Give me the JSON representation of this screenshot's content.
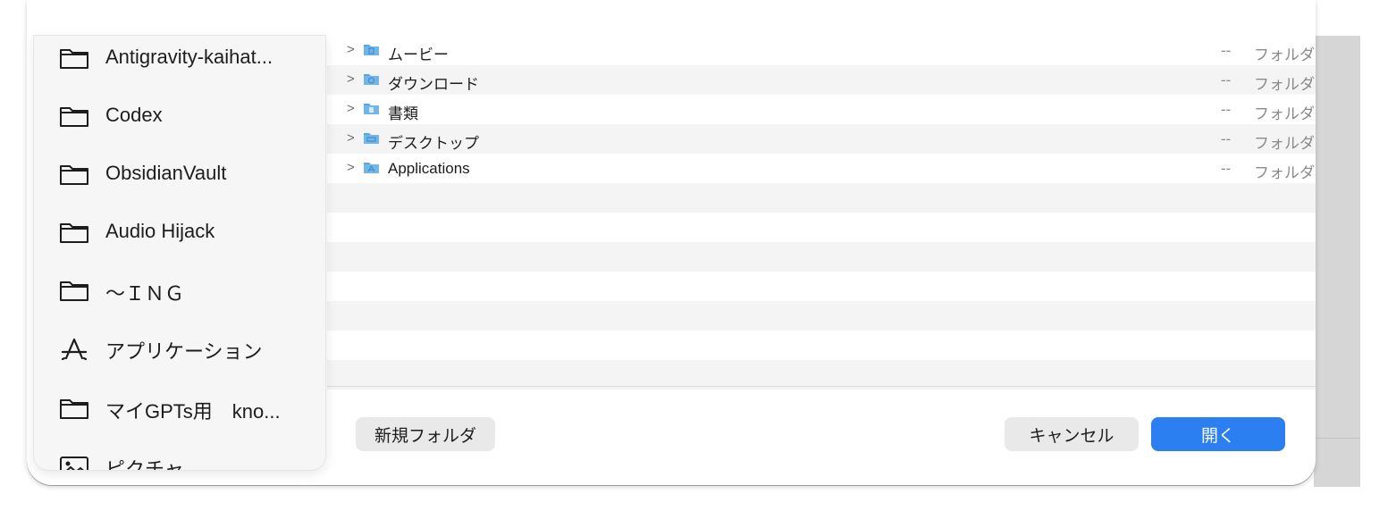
{
  "colors": {
    "accent": "#2b7ff1",
    "folder_blue": "#5aa7e0"
  },
  "sidebar": {
    "items": [
      {
        "label": "Antigravity-kaihat...",
        "icon": "folder-icon"
      },
      {
        "label": "Codex",
        "icon": "folder-icon"
      },
      {
        "label": "ObsidianVault",
        "icon": "folder-icon"
      },
      {
        "label": "Audio Hijack",
        "icon": "folder-icon"
      },
      {
        "label": "～ＩＮＧ",
        "icon": "folder-icon"
      },
      {
        "label": "アプリケーション",
        "icon": "applications-icon"
      },
      {
        "label": "マイGPTs用　kno...",
        "icon": "folder-icon"
      },
      {
        "label": "ピクチャ",
        "icon": "pictures-icon"
      }
    ]
  },
  "file_list": {
    "rows": [
      {
        "name": "ムービー",
        "date": "--",
        "kind": "フォルダ",
        "icon": "movies-folder-icon"
      },
      {
        "name": "ダウンロード",
        "date": "--",
        "kind": "フォルダ",
        "icon": "downloads-folder-icon"
      },
      {
        "name": "書類",
        "date": "--",
        "kind": "フォルダ",
        "icon": "documents-folder-icon"
      },
      {
        "name": "デスクトップ",
        "date": "--",
        "kind": "フォルダ",
        "icon": "desktop-folder-icon"
      },
      {
        "name": "Applications",
        "date": "--",
        "kind": "フォルダ",
        "icon": "applications-folder-icon"
      }
    ]
  },
  "footer": {
    "new_folder_label": "新規フォルダ",
    "cancel_label": "キャンセル",
    "open_label": "開く"
  }
}
